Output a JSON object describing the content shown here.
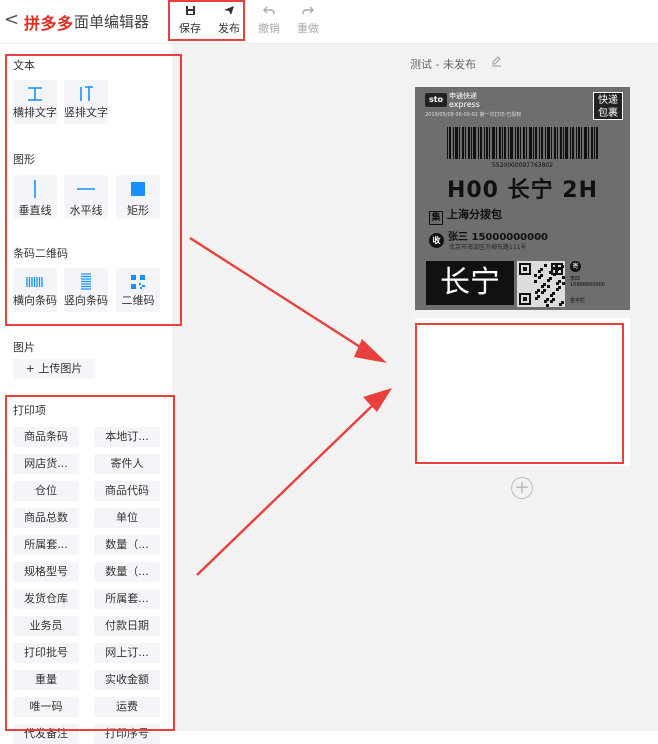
{
  "header": {
    "back_icon": "chevron-left-icon",
    "brand": "拼多多",
    "title": "面单编辑器",
    "tools": [
      {
        "label": "保存",
        "icon": "save-icon",
        "glyph": "🖫",
        "enabled": true
      },
      {
        "label": "发布",
        "icon": "send-icon",
        "glyph": "➤",
        "enabled": true
      },
      {
        "label": "撤销",
        "icon": "undo-icon",
        "glyph": "↶",
        "enabled": false
      },
      {
        "label": "重做",
        "icon": "redo-icon",
        "glyph": "↷",
        "enabled": false
      }
    ]
  },
  "left_panel": {
    "text_section": {
      "title": "文本",
      "items": [
        {
          "label": "横排文字",
          "icon": "horizontal-text-icon"
        },
        {
          "label": "竖排文字",
          "icon": "vertical-text-icon"
        }
      ]
    },
    "shape_section": {
      "title": "图形",
      "items": [
        {
          "label": "垂直线",
          "icon": "vertical-line-icon"
        },
        {
          "label": "水平线",
          "icon": "horizontal-line-icon"
        },
        {
          "label": "矩形",
          "icon": "rectangle-icon"
        }
      ]
    },
    "code_section": {
      "title": "条码二维码",
      "items": [
        {
          "label": "横向条码",
          "icon": "horizontal-barcode-icon"
        },
        {
          "label": "竖向条码",
          "icon": "vertical-barcode-icon"
        },
        {
          "label": "二维码",
          "icon": "qrcode-icon"
        }
      ]
    },
    "image_section": {
      "title": "图片",
      "upload_label": "+ 上传图片"
    },
    "print_section": {
      "title": "打印项",
      "items": [
        "商品条码",
        "本地订...",
        "网店货...",
        "寄件人",
        "仓位",
        "商品代码",
        "商品总数",
        "单位",
        "所属套...",
        "数量（...",
        "规格型号",
        "数量（...",
        "发货仓库",
        "所属套...",
        "业务员",
        "付款日期",
        "打印批号",
        "网上订...",
        "重量",
        "实收金额",
        "唯一码",
        "运费",
        "代发备注",
        "打印序号"
      ]
    }
  },
  "canvas": {
    "template_name": "测试 - 未发布",
    "edit_icon": "edit-icon",
    "label": {
      "carrier_logo": "sto",
      "carrier_cn": "申通快递",
      "carrier_en": "express",
      "meta": "2019/05/08  06:00:01   第一次打印-已授权",
      "badge": "快递包裹",
      "barcode_number": "5520000097763802",
      "hub_code": "H00 长宁 2H",
      "pack_icon": "集",
      "package_center": "上海分拨包",
      "receiver_icon": "收",
      "receiver": "张三  15000000000",
      "address": "北京市海淀区万柳东路111号",
      "city": "长宁",
      "sender_icon": "寄",
      "sender_name": "李四",
      "sender_phone": "16866660000",
      "sign": "签字栏"
    },
    "add_page_icon": "plus-circle-icon"
  },
  "colors": {
    "highlight": "#e8403d",
    "brand": "#e02e24",
    "icon_blue": "#1890ff",
    "canvas_bg": "#f2f2f2"
  }
}
